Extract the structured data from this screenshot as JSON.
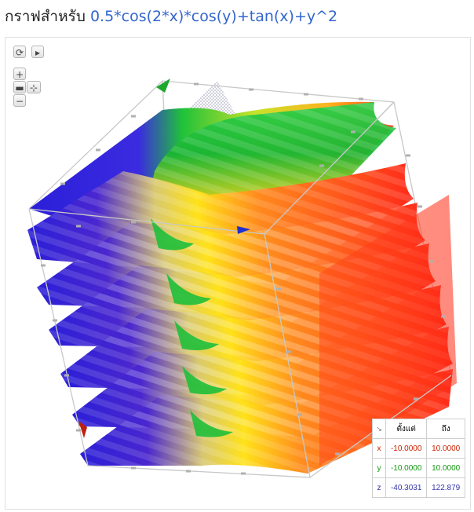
{
  "header": {
    "label": "กราฟสำหรับ",
    "expression": "0.5*cos(2*x)*cos(y)+tan(x)+y^2"
  },
  "controls": [
    {
      "name": "reset-view-button",
      "icon": "refresh-icon",
      "glyph": "⟳"
    },
    {
      "name": "play-button",
      "icon": "play-icon",
      "glyph": "▸"
    },
    {
      "name": "zoom-in-button",
      "icon": "plus-icon",
      "glyph": "+"
    },
    {
      "name": "camera-button",
      "icon": "camera-icon",
      "glyph": "▬"
    },
    {
      "name": "axes-toggle-button",
      "icon": "axes-icon",
      "glyph": "⊹"
    },
    {
      "name": "zoom-out-button",
      "icon": "minus-icon",
      "glyph": "−"
    }
  ],
  "range_table": {
    "col_from": "ตั้งแต่",
    "col_to": "ถึง",
    "rows": [
      {
        "var": "x",
        "from": "-10.0000",
        "to": "10.0000",
        "color": "#cc2200"
      },
      {
        "var": "y",
        "from": "-10.0000",
        "to": "10.0000",
        "color": "#119911"
      },
      {
        "var": "z",
        "from": "-40.3031",
        "to": "122.879",
        "color": "#3333aa"
      }
    ]
  },
  "colors": {
    "expression": "#3366cc",
    "low": "#2a1fd8",
    "high": "#ff2a1a"
  }
}
